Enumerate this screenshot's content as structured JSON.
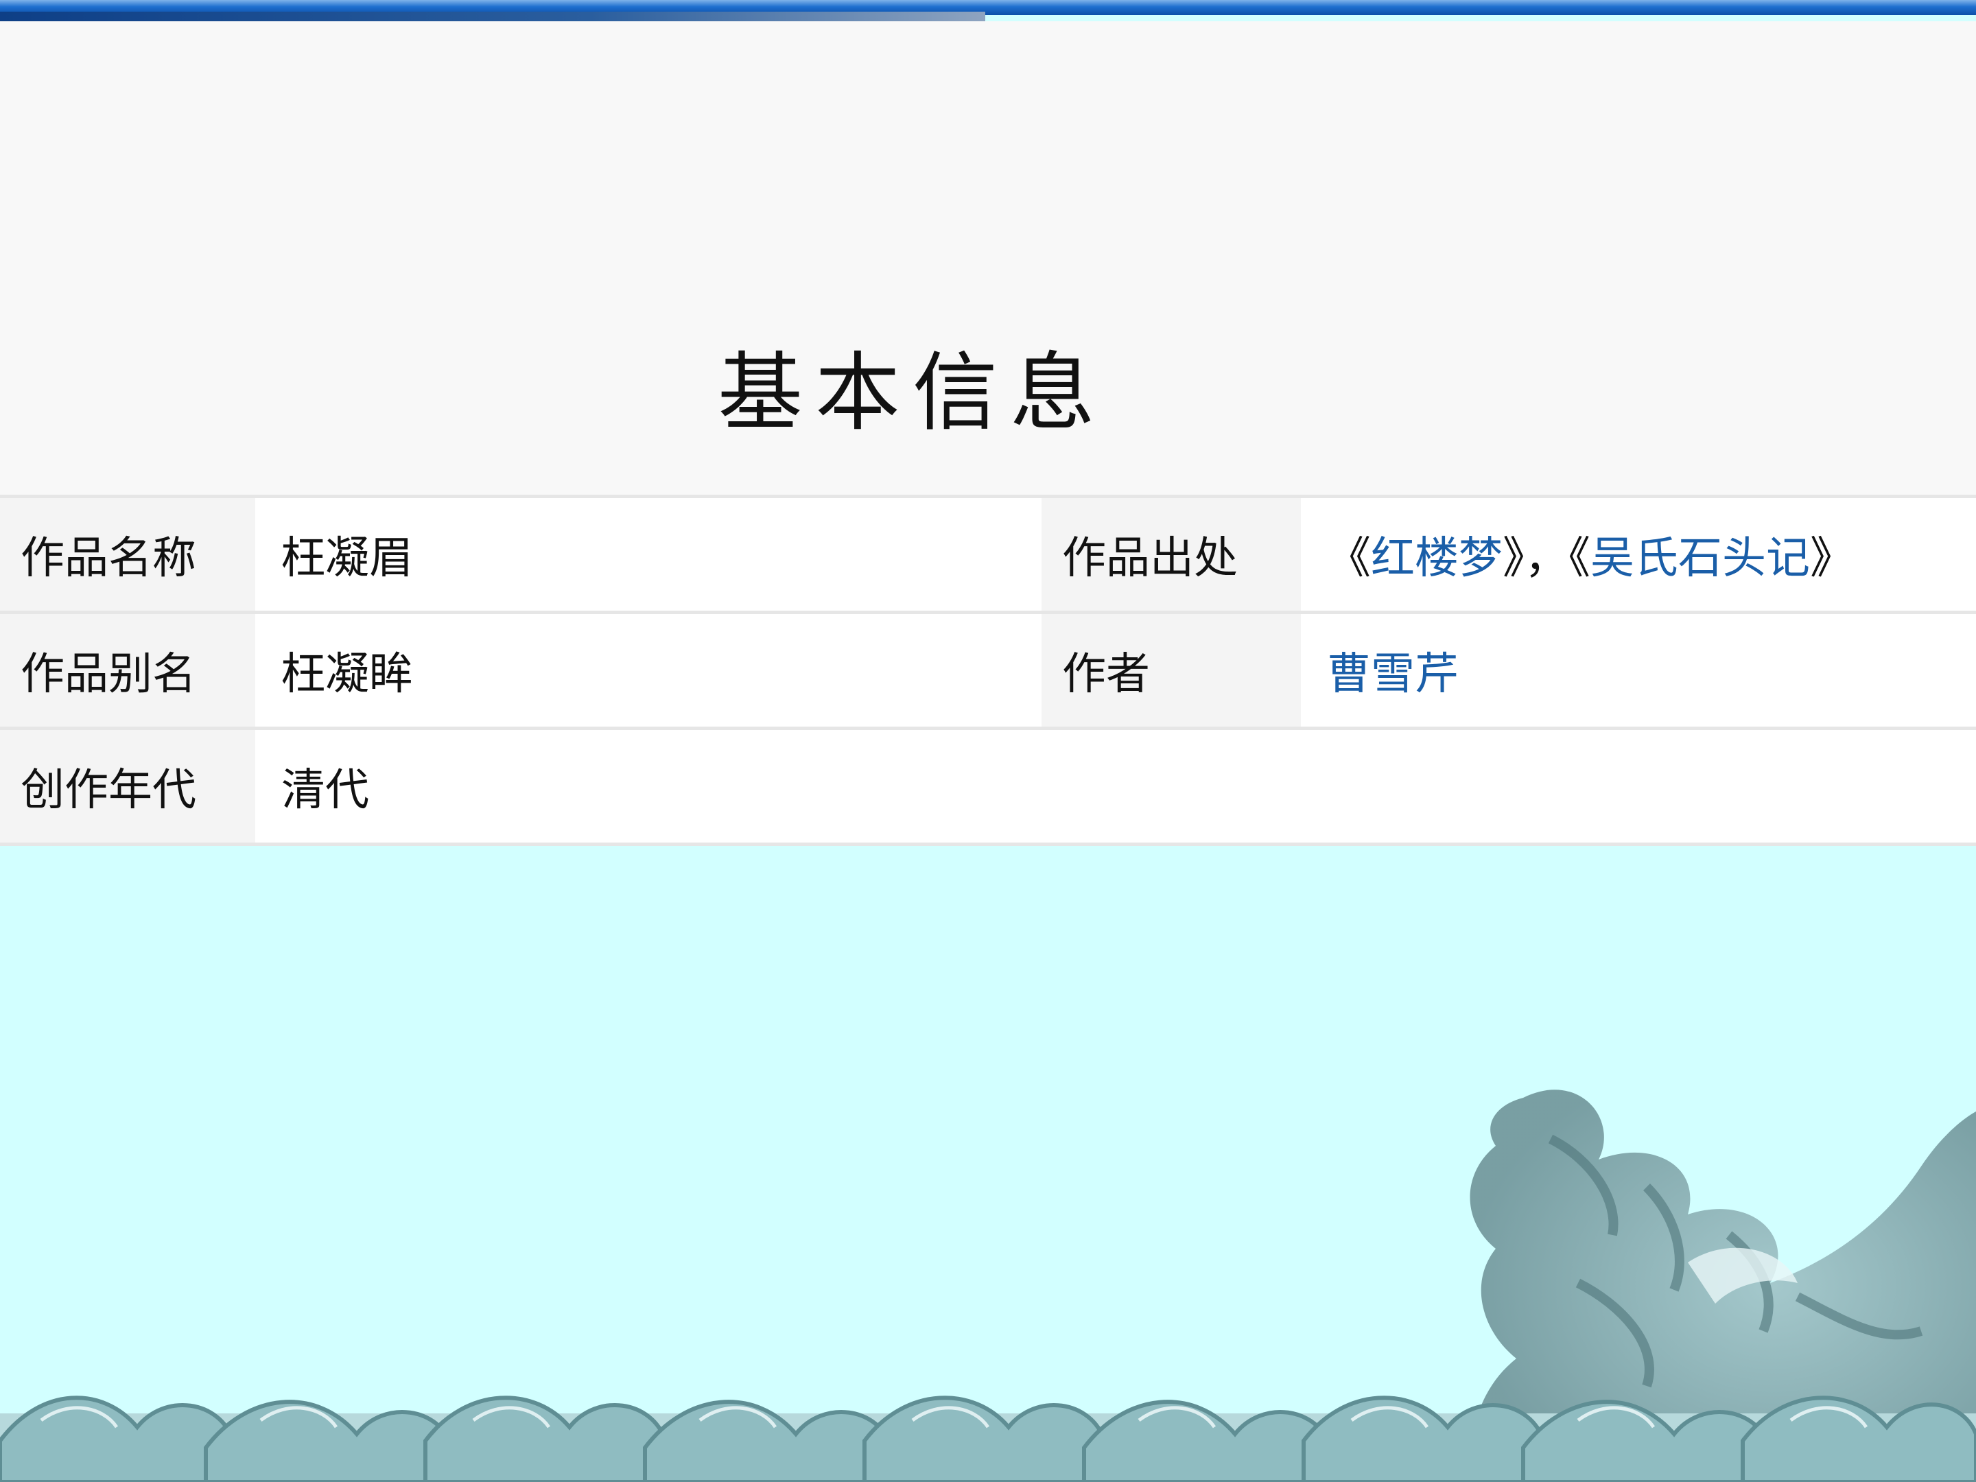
{
  "page": {
    "title": "基本信息"
  },
  "table": {
    "rows": [
      {
        "label_left": "作品名称",
        "value_left": "枉凝眉",
        "label_right": "作品出处",
        "value_right": {
          "q1_open": "《",
          "link1": "红楼梦",
          "q1_close": "》，",
          "q2_open": "《",
          "link2": "吴氏石头记",
          "q2_close": "》"
        }
      },
      {
        "label_left": "作品别名",
        "value_left": "枉凝眸",
        "label_right": "作者",
        "value_right_link": "曹雪芹"
      },
      {
        "label_left": "创作年代",
        "value_left": "清代"
      }
    ]
  },
  "colors": {
    "link": "#1a5ea8",
    "background": "#d2ffff",
    "topbar": "#1f6fcf"
  }
}
